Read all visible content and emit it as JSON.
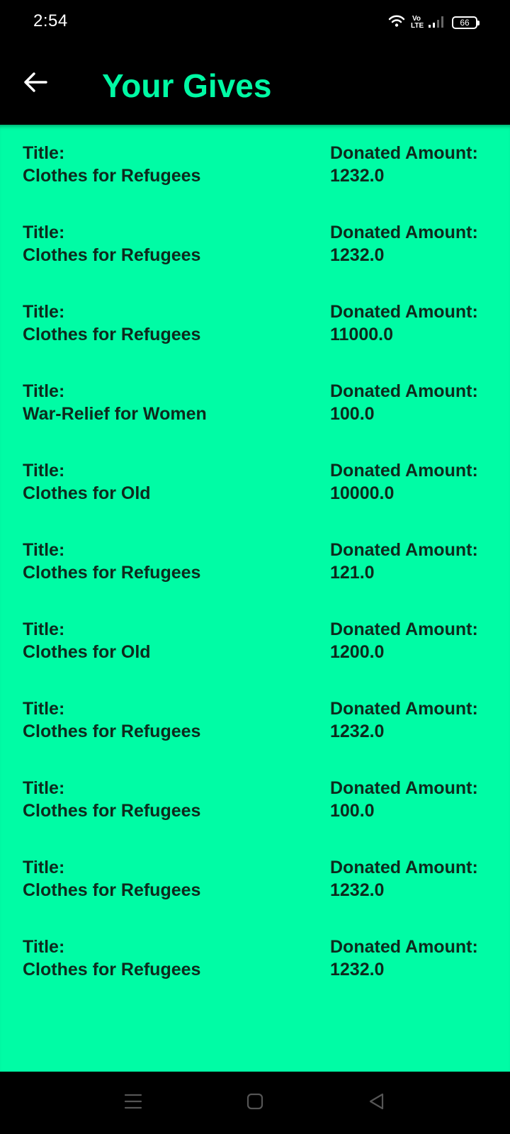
{
  "status_bar": {
    "time": "2:54",
    "volte_top": "Vo",
    "volte_bottom": "LTE",
    "battery": "66",
    "icons": [
      "wifi-icon",
      "volte-icon",
      "signal-icon",
      "battery-icon"
    ]
  },
  "app_bar": {
    "title": "Your Gives",
    "back_icon": "arrow-left-icon"
  },
  "colors": {
    "accent": "#00f9a4",
    "list_background": "#00fca5",
    "text": "#0d2a1d",
    "bar_background": "#000000"
  },
  "gives": [
    {
      "title_label": "Title:",
      "title": "Clothes for Refugees",
      "amount_label": "Donated Amount:",
      "amount": "1232.0"
    },
    {
      "title_label": "Title:",
      "title": "Clothes for Refugees",
      "amount_label": "Donated Amount:",
      "amount": "1232.0"
    },
    {
      "title_label": "Title:",
      "title": "Clothes for Refugees",
      "amount_label": "Donated Amount:",
      "amount": "11000.0"
    },
    {
      "title_label": "Title:",
      "title": "War-Relief for Women",
      "amount_label": "Donated Amount:",
      "amount": "100.0"
    },
    {
      "title_label": "Title:",
      "title": "Clothes for Old",
      "amount_label": "Donated Amount:",
      "amount": "10000.0"
    },
    {
      "title_label": "Title:",
      "title": "Clothes for Refugees",
      "amount_label": "Donated Amount:",
      "amount": "121.0"
    },
    {
      "title_label": "Title:",
      "title": "Clothes for Old",
      "amount_label": "Donated Amount:",
      "amount": "1200.0"
    },
    {
      "title_label": "Title:",
      "title": "Clothes for Refugees",
      "amount_label": "Donated Amount:",
      "amount": "1232.0"
    },
    {
      "title_label": "Title:",
      "title": "Clothes for Refugees",
      "amount_label": "Donated Amount:",
      "amount": "100.0"
    },
    {
      "title_label": "Title:",
      "title": "Clothes for Refugees",
      "amount_label": "Donated Amount:",
      "amount": "1232.0"
    },
    {
      "title_label": "Title:",
      "title": "Clothes for Refugees",
      "amount_label": "Donated Amount:",
      "amount": "1232.0"
    }
  ],
  "nav_bar": {
    "icons": [
      "menu-icon",
      "home-icon",
      "back-triangle-icon"
    ]
  }
}
